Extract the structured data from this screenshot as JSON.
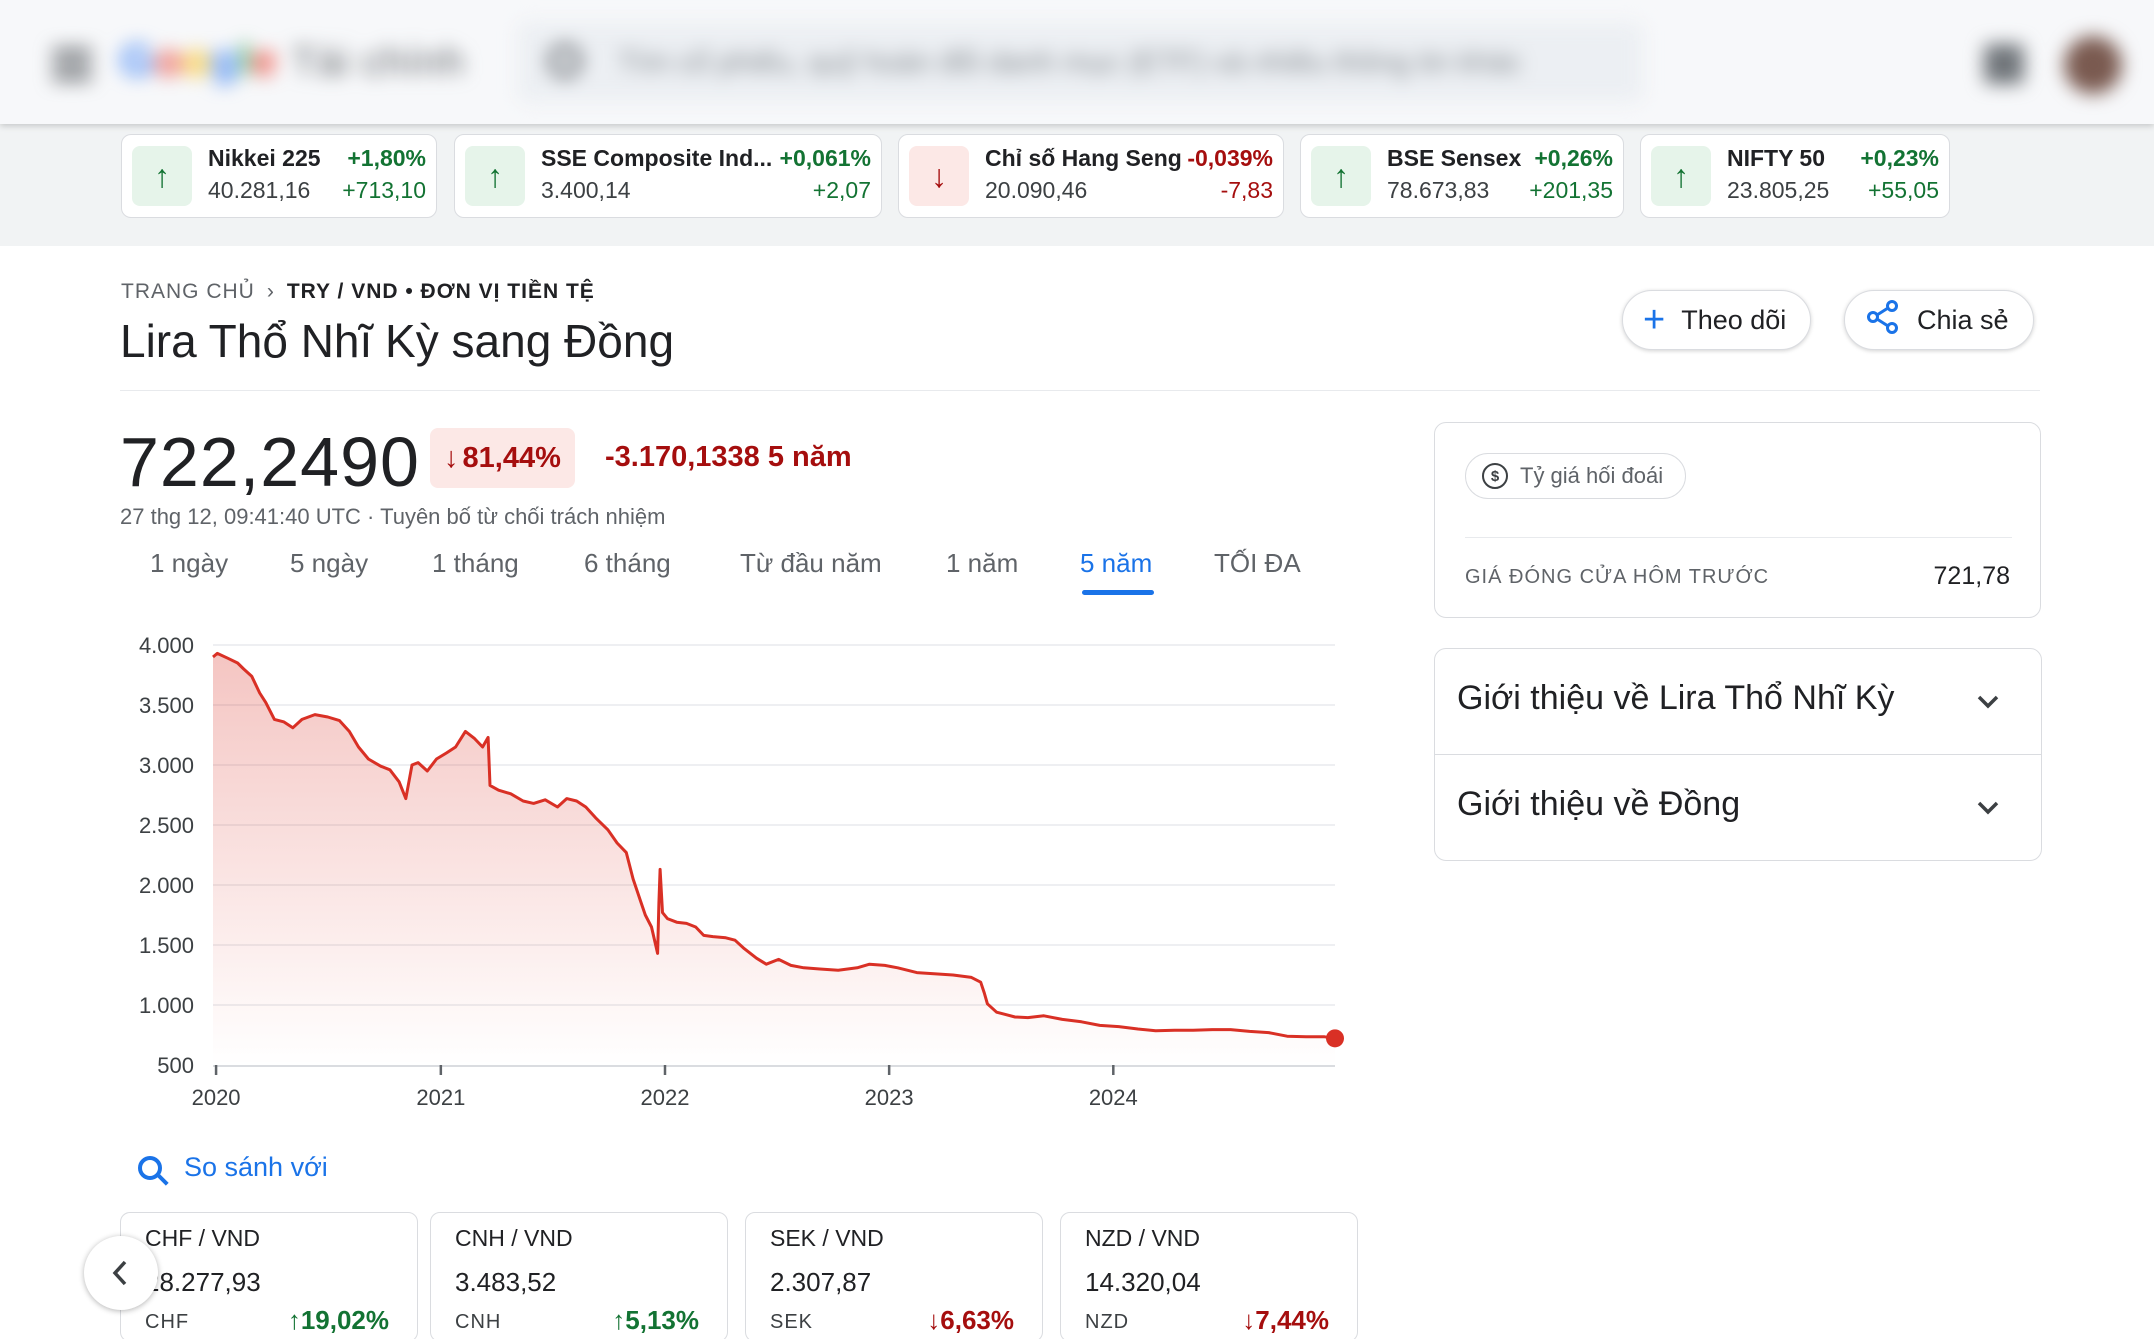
{
  "header": {
    "logo_google": "Google",
    "logo_product": "Tài chính",
    "search_placeholder": "Tìm cổ phiếu, quỹ hoán đổi danh mục (ETF) và nhiều thông tin khác"
  },
  "ticker": [
    {
      "name": "Nikkei 225",
      "value": "40.281,16",
      "pct": "+1,80%",
      "change": "+713,10",
      "direction": "up"
    },
    {
      "name": "SSE Composite Ind...",
      "value": "3.400,14",
      "pct": "+0,061%",
      "change": "+2,07",
      "direction": "up"
    },
    {
      "name": "Chỉ số Hang Seng",
      "value": "20.090,46",
      "pct": "-0,039%",
      "change": "-7,83",
      "direction": "down"
    },
    {
      "name": "BSE Sensex",
      "value": "78.673,83",
      "pct": "+0,26%",
      "change": "+201,35",
      "direction": "up"
    },
    {
      "name": "NIFTY 50",
      "value": "23.805,25",
      "pct": "+0,23%",
      "change": "+55,05",
      "direction": "up"
    }
  ],
  "breadcrumb": {
    "home": "TRANG CHỦ",
    "current": "TRY / VND • ĐƠN VỊ TIỀN TỆ"
  },
  "title": "Lira Thổ Nhĩ Kỳ sang Đồng",
  "actions": {
    "follow": "Theo dõi",
    "share": "Chia sẻ"
  },
  "quote": {
    "price": "722,2490",
    "pct_change": "81,44%",
    "abs_change": "-3.170,1338 5 năm",
    "timestamp": "27 thg 12, 09:41:40 UTC · Tuyên bố từ chối trách nhiệm"
  },
  "ranges": [
    "1 ngày",
    "5 ngày",
    "1 tháng",
    "6 tháng",
    "Từ đầu năm",
    "1 năm",
    "5 năm",
    "TỐI ĐA"
  ],
  "active_range": "5 năm",
  "chart_data": {
    "type": "area",
    "xlabel": "",
    "ylabel": "",
    "x_ticks": [
      "2020",
      "2021",
      "2022",
      "2023",
      "2024"
    ],
    "y_ticks": [
      "500",
      "1.000",
      "1.500",
      "2.000",
      "2.500",
      "3.000",
      "3.500",
      "4.000"
    ],
    "ylim": [
      500,
      4000
    ],
    "xlim": [
      "2019-12-27",
      "2024-12-27"
    ],
    "grid": true,
    "color": "#d93025",
    "series": [
      {
        "values": [
          [
            "2019-12-27",
            3900
          ],
          [
            "2020-01-03",
            3930
          ],
          [
            "2020-01-20",
            3890
          ],
          [
            "2020-02-05",
            3850
          ],
          [
            "2020-02-15",
            3800
          ],
          [
            "2020-02-28",
            3740
          ],
          [
            "2020-03-12",
            3600
          ],
          [
            "2020-03-22",
            3520
          ],
          [
            "2020-04-05",
            3380
          ],
          [
            "2020-04-20",
            3360
          ],
          [
            "2020-05-05",
            3310
          ],
          [
            "2020-05-20",
            3380
          ],
          [
            "2020-06-10",
            3420
          ],
          [
            "2020-07-01",
            3400
          ],
          [
            "2020-07-20",
            3370
          ],
          [
            "2020-08-05",
            3280
          ],
          [
            "2020-08-20",
            3150
          ],
          [
            "2020-09-05",
            3050
          ],
          [
            "2020-09-25",
            2990
          ],
          [
            "2020-10-10",
            2960
          ],
          [
            "2020-10-25",
            2860
          ],
          [
            "2020-11-05",
            2720
          ],
          [
            "2020-11-15",
            3000
          ],
          [
            "2020-11-25",
            3020
          ],
          [
            "2020-12-10",
            2950
          ],
          [
            "2020-12-25",
            3050
          ],
          [
            "2021-01-10",
            3100
          ],
          [
            "2021-01-25",
            3150
          ],
          [
            "2021-02-10",
            3280
          ],
          [
            "2021-02-25",
            3220
          ],
          [
            "2021-03-10",
            3150
          ],
          [
            "2021-03-19",
            3230
          ],
          [
            "2021-03-22",
            2830
          ],
          [
            "2021-04-05",
            2790
          ],
          [
            "2021-04-25",
            2760
          ],
          [
            "2021-05-15",
            2700
          ],
          [
            "2021-06-01",
            2680
          ],
          [
            "2021-06-20",
            2710
          ],
          [
            "2021-07-10",
            2650
          ],
          [
            "2021-07-25",
            2720
          ],
          [
            "2021-08-10",
            2700
          ],
          [
            "2021-08-25",
            2650
          ],
          [
            "2021-09-10",
            2560
          ],
          [
            "2021-09-30",
            2460
          ],
          [
            "2021-10-15",
            2350
          ],
          [
            "2021-10-30",
            2270
          ],
          [
            "2021-11-10",
            2050
          ],
          [
            "2021-11-22",
            1870
          ],
          [
            "2021-11-30",
            1750
          ],
          [
            "2021-12-10",
            1650
          ],
          [
            "2021-12-20",
            1430
          ],
          [
            "2021-12-22",
            1850
          ],
          [
            "2021-12-24",
            2130
          ],
          [
            "2021-12-28",
            1770
          ],
          [
            "2022-01-05",
            1720
          ],
          [
            "2022-01-20",
            1690
          ],
          [
            "2022-02-05",
            1680
          ],
          [
            "2022-02-20",
            1650
          ],
          [
            "2022-03-05",
            1580
          ],
          [
            "2022-03-20",
            1570
          ],
          [
            "2022-04-10",
            1560
          ],
          [
            "2022-04-25",
            1540
          ],
          [
            "2022-05-10",
            1470
          ],
          [
            "2022-05-30",
            1390
          ],
          [
            "2022-06-15",
            1340
          ],
          [
            "2022-07-05",
            1380
          ],
          [
            "2022-07-25",
            1330
          ],
          [
            "2022-08-15",
            1310
          ],
          [
            "2022-09-10",
            1300
          ],
          [
            "2022-10-10",
            1290
          ],
          [
            "2022-11-10",
            1310
          ],
          [
            "2022-11-30",
            1340
          ],
          [
            "2022-12-25",
            1330
          ],
          [
            "2023-01-15",
            1310
          ],
          [
            "2023-02-15",
            1270
          ],
          [
            "2023-03-15",
            1260
          ],
          [
            "2023-04-15",
            1250
          ],
          [
            "2023-05-15",
            1230
          ],
          [
            "2023-05-30",
            1190
          ],
          [
            "2023-06-05",
            1100
          ],
          [
            "2023-06-10",
            1010
          ],
          [
            "2023-06-25",
            940
          ],
          [
            "2023-07-10",
            920
          ],
          [
            "2023-07-25",
            900
          ],
          [
            "2023-08-15",
            895
          ],
          [
            "2023-09-10",
            910
          ],
          [
            "2023-10-10",
            880
          ],
          [
            "2023-11-10",
            860
          ],
          [
            "2023-12-10",
            830
          ],
          [
            "2024-01-10",
            820
          ],
          [
            "2024-02-10",
            800
          ],
          [
            "2024-03-10",
            785
          ],
          [
            "2024-04-10",
            790
          ],
          [
            "2024-05-10",
            790
          ],
          [
            "2024-06-10",
            795
          ],
          [
            "2024-07-10",
            795
          ],
          [
            "2024-08-10",
            780
          ],
          [
            "2024-09-10",
            770
          ],
          [
            "2024-10-10",
            740
          ],
          [
            "2024-11-10",
            735
          ],
          [
            "2024-12-10",
            735
          ],
          [
            "2024-12-27",
            722
          ]
        ]
      }
    ]
  },
  "compare": {
    "label": "So sánh với",
    "cards": [
      {
        "pair": "CHF / VND",
        "value": "28.277,93",
        "code": "CHF",
        "pct": "19,02%",
        "direction": "up"
      },
      {
        "pair": "CNH / VND",
        "value": "3.483,52",
        "code": "CNH",
        "pct": "5,13%",
        "direction": "up"
      },
      {
        "pair": "SEK / VND",
        "value": "2.307,87",
        "code": "SEK",
        "pct": "6,63%",
        "direction": "down"
      },
      {
        "pair": "NZD / VND",
        "value": "14.320,04",
        "code": "NZD",
        "pct": "7,44%",
        "direction": "down"
      }
    ]
  },
  "side": {
    "chip": "Tỷ giá hối đoái",
    "prev_close_label": "GIÁ ĐÓNG CỬA HÔM TRƯỚC",
    "prev_close_value": "721,78",
    "about": [
      "Giới thiệu về Lira Thổ Nhĩ Kỳ",
      "Giới thiệu về Đồng"
    ]
  },
  "colors": {
    "accent": "#1a73e8",
    "positive": "#137333",
    "negative": "#a50e0e",
    "chart_line": "#d93025"
  }
}
